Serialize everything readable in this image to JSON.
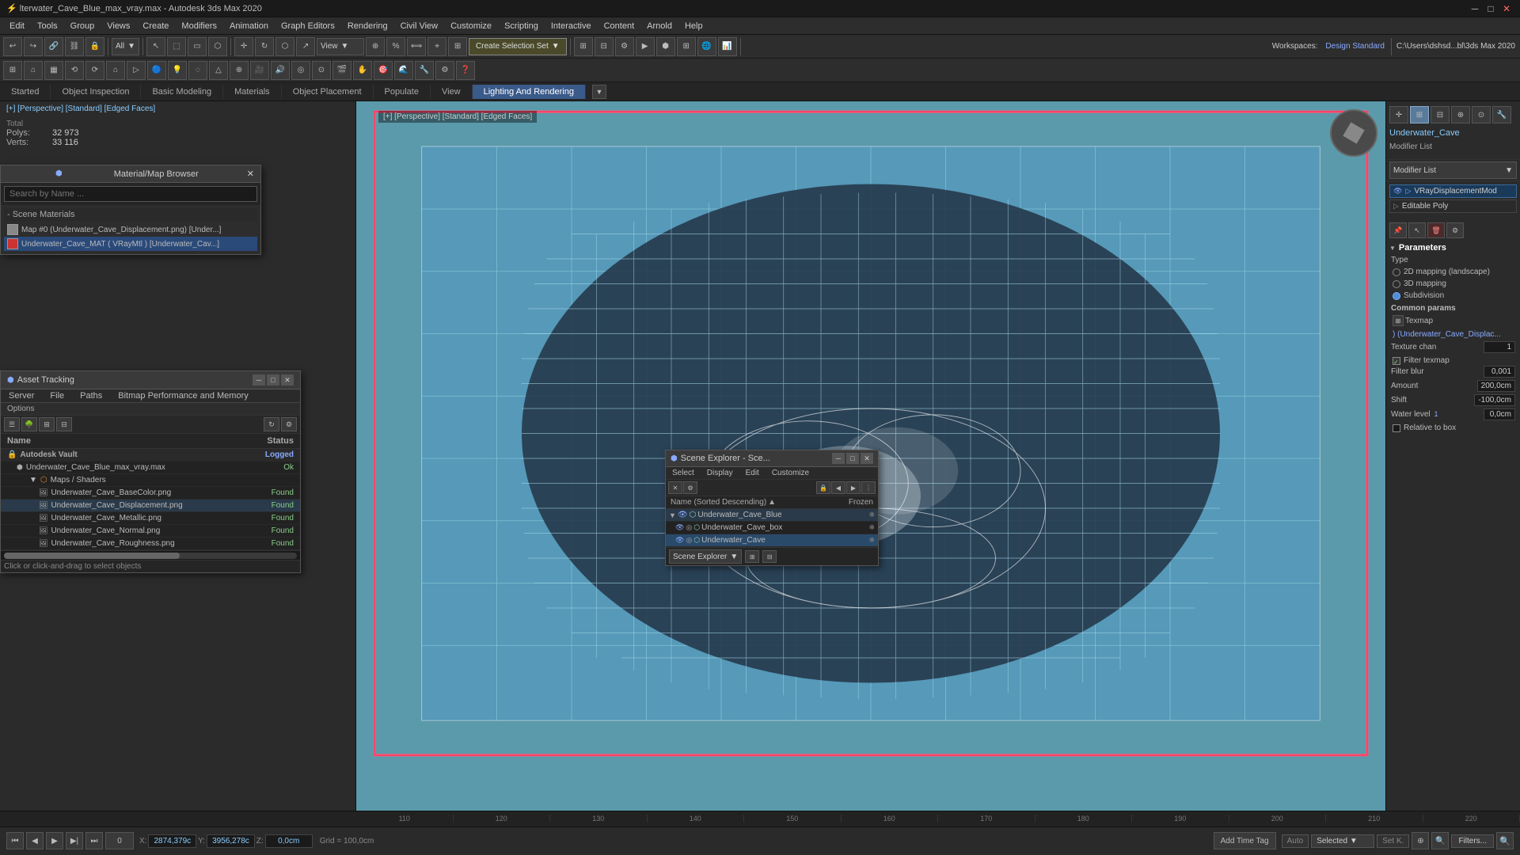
{
  "titlebar": {
    "title": "lterwater_Cave_Blue_max_vray.max - Autodesk 3ds Max 2020",
    "minimize": "─",
    "maximize": "□",
    "close": "✕"
  },
  "menubar": {
    "items": [
      "Edit",
      "Tools",
      "Group",
      "Views",
      "Create",
      "Modifiers",
      "Animation",
      "Graph Editors",
      "Rendering",
      "Civil View",
      "Customize",
      "Scripting",
      "Interactive",
      "Content",
      "Arnold",
      "Help"
    ]
  },
  "toolbar1": {
    "dropdown_label": "All",
    "create_selection": "Create Selection Set",
    "workspace_label": "Workspaces:",
    "workspace_value": "Design Standard",
    "path": "C:\\Users\\dshsd...bl\\3ds Max 2020"
  },
  "viewport_info": {
    "label": "[+] [Perspective] [Standard] [Edged Faces]"
  },
  "stats": {
    "total_label": "Total",
    "polys_label": "Polys:",
    "polys_value": "32 973",
    "verts_label": "Verts:",
    "verts_value": "33 116"
  },
  "tabs": {
    "items": [
      "Started",
      "Object Inspection",
      "Basic Modeling",
      "Materials",
      "Object Placement",
      "Populate",
      "View",
      "Lighting And Rendering"
    ]
  },
  "mat_browser": {
    "title": "Material/Map Browser",
    "search_placeholder": "Search by Name ...",
    "section_materials": "- Scene Materials",
    "item1_name": "Map #0 (Underwater_Cave_Displacement.png)  [Under...]",
    "item2_name": "Underwater_Cave_MAT ( VRayMtl )  [Underwater_Cav...]"
  },
  "asset_tracking": {
    "title": "Asset Tracking",
    "menu": [
      "Server",
      "File",
      "Paths",
      "Bitmap Performance and Memory"
    ],
    "options": "Options",
    "header_name": "Name",
    "header_status": "Status",
    "vault_name": "Autodesk Vault",
    "vault_status": "Logged",
    "file_name": "Underwater_Cave_Blue_max_vray.max",
    "file_status": "Ok",
    "maps_group": "Maps / Shaders",
    "files": [
      {
        "name": "Underwater_Cave_BaseColor.png",
        "status": "Found"
      },
      {
        "name": "Underwater_Cave_Displacement.png",
        "status": "Found"
      },
      {
        "name": "Underwater_Cave_Metallic.png",
        "status": "Found"
      },
      {
        "name": "Underwater_Cave_Normal.png",
        "status": "Found"
      },
      {
        "name": "Underwater_Cave_Roughness.png",
        "status": "Found"
      }
    ],
    "bottom_text": "Click or click-and-drag to select objects"
  },
  "scene_explorer": {
    "title": "Scene Explorer - Sce...",
    "menu": [
      "Select",
      "Display",
      "Edit",
      "Customize"
    ],
    "col_name": "Name (Sorted Descending)",
    "col_frozen": "Frozen",
    "items": [
      {
        "name": "Underwater_Cave_Blue",
        "indent": 0,
        "is_parent": true
      },
      {
        "name": "Underwater_Cave_box",
        "indent": 1
      },
      {
        "name": "Underwater_Cave",
        "indent": 1
      }
    ],
    "footer": "Scene Explorer"
  },
  "right_panel": {
    "object_name": "Underwater_Cave",
    "modifier_list_label": "Modifier List",
    "modifiers": [
      {
        "name": "VRayDisplacementMod",
        "active": true
      },
      {
        "name": "Editable Poly",
        "active": false
      }
    ],
    "params_title": "Parameters",
    "type_label": "Type",
    "type_2d": "2D mapping (landscape)",
    "type_3d": "3D mapping",
    "type_sub": "Subdivision",
    "common_params": "Common params",
    "texmap_label": "Texmap",
    "texmap_value": ") (Underwater_Cave_Displac...",
    "texture_chan_label": "Texture chan",
    "texture_chan_value": "1",
    "filter_texmap": "Filter texmap",
    "filter_blur_label": "Filter blur",
    "filter_blur_value": "0,001",
    "amount_label": "Amount",
    "amount_value": "200,0cm",
    "shift_label": "Shift",
    "shift_value": "-100,0cm",
    "water_level_label": "Water level",
    "water_level_value": "0,0cm",
    "relative_to_bbox": "Relative to box"
  },
  "timeline": {
    "ticks": [
      "110",
      "120",
      "130",
      "140",
      "150",
      "160",
      "170",
      "180",
      "190",
      "200",
      "210",
      "220"
    ]
  },
  "controls": {
    "x_label": "X:",
    "x_value": "2874,379c",
    "y_label": "Y:",
    "y_value": "3956,278c",
    "z_label": "Z:",
    "z_value": "0,0cm",
    "grid_label": "Grid = 100,0cm",
    "add_time_tag": "Add Time Tag",
    "auto": "Auto",
    "selected": "Selected",
    "set_k": "Set K.",
    "filters": "Filters..."
  },
  "status_bar": {
    "text": "Click or click-and-drag to select objects"
  }
}
